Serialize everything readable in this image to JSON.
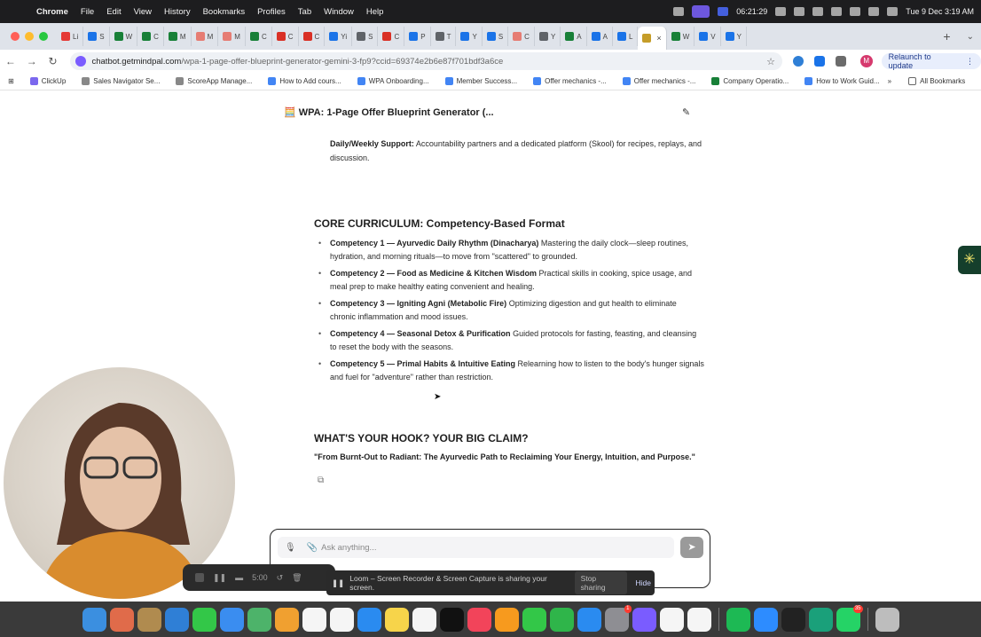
{
  "menubar": {
    "app_name": "Chrome",
    "items": [
      "File",
      "Edit",
      "View",
      "History",
      "Bookmarks",
      "Profiles",
      "Tab",
      "Window",
      "Help"
    ],
    "time_short": "06:21:29",
    "datetime": "Tue 9 Dec  3:19 AM"
  },
  "tabs": [
    {
      "label": "Li",
      "color": "#e53935"
    },
    {
      "label": "S",
      "color": "#1a73e8"
    },
    {
      "label": "W",
      "color": "#188038"
    },
    {
      "label": "C",
      "color": "#188038"
    },
    {
      "label": "M",
      "color": "#188038"
    },
    {
      "label": "M",
      "color": "#e67c73"
    },
    {
      "label": "M",
      "color": "#e67c73"
    },
    {
      "label": "C",
      "color": "#188038"
    },
    {
      "label": "C",
      "color": "#d93025"
    },
    {
      "label": "C",
      "color": "#d93025"
    },
    {
      "label": "Yi",
      "color": "#1a73e8"
    },
    {
      "label": "S",
      "color": "#5f6368"
    },
    {
      "label": "C",
      "color": "#d93025"
    },
    {
      "label": "P",
      "color": "#1a73e8"
    },
    {
      "label": "T",
      "color": "#5f6368"
    },
    {
      "label": "Y",
      "color": "#1a73e8"
    },
    {
      "label": "S",
      "color": "#1a73e8"
    },
    {
      "label": "C",
      "color": "#e67c73"
    },
    {
      "label": "Y",
      "color": "#5f6368"
    },
    {
      "label": "A",
      "color": "#188038"
    },
    {
      "label": "A",
      "color": "#1a73e8"
    },
    {
      "label": "L",
      "color": "#1a73e8"
    },
    {
      "label": "",
      "color": "#c59d29",
      "active": true
    },
    {
      "label": "W",
      "color": "#188038"
    },
    {
      "label": "V",
      "color": "#1a73e8"
    },
    {
      "label": "Y",
      "color": "#1a73e8"
    }
  ],
  "address": {
    "domain": "chatbot.getmindpal.com",
    "path": "/wpa-1-page-offer-blueprint-generator-gemini-3-fp9?ccid=69374e2b6e87f701bdf3a6ce",
    "relaunch_label": "Relaunch to update",
    "profile_initial": "M"
  },
  "bookmarks": [
    {
      "label": "ClickUp",
      "color": "#7b68ee"
    },
    {
      "label": "Sales Navigator Se...",
      "color": "#888"
    },
    {
      "label": "ScoreApp Manage...",
      "color": "#888"
    },
    {
      "label": "How to Add cours...",
      "color": "#4285f4"
    },
    {
      "label": "WPA Onboarding...",
      "color": "#4285f4"
    },
    {
      "label": "Member Success...",
      "color": "#4285f4"
    },
    {
      "label": "Offer mechanics -...",
      "color": "#4285f4"
    },
    {
      "label": "Offer mechanics -...",
      "color": "#4285f4"
    },
    {
      "label": "Company Operatio...",
      "color": "#188038"
    },
    {
      "label": "How to Work Guid...",
      "color": "#4285f4"
    }
  ],
  "bookmarks_end": {
    "more": "»",
    "all_label": "All Bookmarks"
  },
  "chat": {
    "title_emoji": "🧮",
    "title": "WPA: 1-Page Offer Blueprint Generator (...",
    "support_label": "Daily/Weekly Support:",
    "support_text": " Accountability partners and a dedicated platform (Skool) for recipes, replays, and discussion.",
    "curriculum_title": "CORE CURRICULUM: Competency-Based Format",
    "competencies": [
      {
        "label": "Competency 1 — Ayurvedic Daily Rhythm (Dinacharya)",
        "text": " Mastering the daily clock—sleep routines, hydration, and morning rituals—to move from \"scattered\" to grounded."
      },
      {
        "label": "Competency 2 — Food as Medicine & Kitchen Wisdom",
        "text": " Practical skills in cooking, spice usage, and meal prep to make healthy eating convenient and healing."
      },
      {
        "label": "Competency 3 — Igniting Agni (Metabolic Fire)",
        "text": " Optimizing digestion and gut health to eliminate chronic inflammation and mood issues."
      },
      {
        "label": "Competency 4 — Seasonal Detox & Purification",
        "text": " Guided protocols for fasting, feasting, and cleansing to reset the body with the seasons."
      },
      {
        "label": "Competency 5 — Primal Habits & Intuitive Eating",
        "text": " Relearning how to listen to the body's hunger signals and fuel for \"adventure\" rather than restriction."
      }
    ],
    "hook_title": "WHAT'S YOUR HOOK? YOUR BIG CLAIM?",
    "hook_text": "\"From Burnt-Out to Radiant: The Ayurvedic Path to Reclaiming Your Energy, Intuition, and Purpose.\"",
    "input_placeholder": "Ask anything..."
  },
  "loom": {
    "timer": "5:00",
    "share_text": "Loom – Screen Recorder & Screen Capture is sharing your screen.",
    "stop_label": "Stop sharing",
    "hide_label": "Hide"
  },
  "dock": [
    {
      "name": "finder",
      "color": "#3b8fe0"
    },
    {
      "name": "launchpad",
      "color": "#e06b4a"
    },
    {
      "name": "folder",
      "color": "#b08b4f"
    },
    {
      "name": "safari",
      "color": "#2f7fd6"
    },
    {
      "name": "messages",
      "color": "#33c748"
    },
    {
      "name": "mail",
      "color": "#3a8df0"
    },
    {
      "name": "maps",
      "color": "#4db36a"
    },
    {
      "name": "photos",
      "color": "#f0a030"
    },
    {
      "name": "calendar",
      "color": "#f5f5f5"
    },
    {
      "name": "reminders",
      "color": "#f5f5f5"
    },
    {
      "name": "keynote",
      "color": "#2a8bf0"
    },
    {
      "name": "notes",
      "color": "#f7d44a"
    },
    {
      "name": "freeform",
      "color": "#f5f5f5"
    },
    {
      "name": "appletv",
      "color": "#111111"
    },
    {
      "name": "music",
      "color": "#f2445a"
    },
    {
      "name": "pages",
      "color": "#f79a1e"
    },
    {
      "name": "facetime",
      "color": "#33c748"
    },
    {
      "name": "numbers",
      "color": "#2fb54a"
    },
    {
      "name": "appstore",
      "color": "#2a8bf0"
    },
    {
      "name": "settings",
      "color": "#8e8e93",
      "badge": "1"
    },
    {
      "name": "feedback",
      "color": "#7a5cff"
    },
    {
      "name": "textedit",
      "color": "#f5f5f5"
    },
    {
      "name": "chrome",
      "color": "#f5f5f5"
    },
    {
      "name": "spotify",
      "color": "#1db954"
    },
    {
      "name": "zoom",
      "color": "#2d8cff"
    },
    {
      "name": "activity-monitor",
      "color": "#222222"
    },
    {
      "name": "loom",
      "color": "#1aa07a"
    },
    {
      "name": "whatsapp",
      "color": "#25d366",
      "badge": "35"
    },
    {
      "name": "trash",
      "color": "#bdbdbd"
    }
  ],
  "colors": {
    "menubar": "#1d1d1f",
    "accent": "#7b61ff",
    "send": "#9a9a9a"
  }
}
